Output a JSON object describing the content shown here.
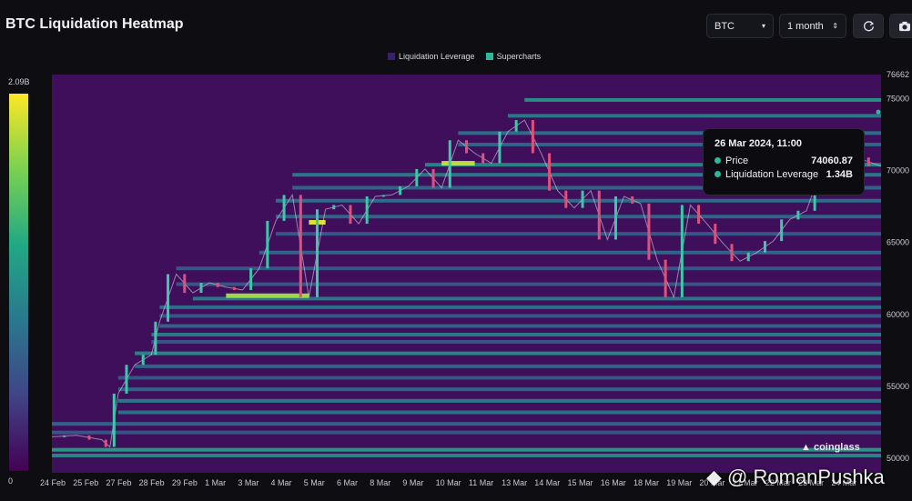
{
  "title": "BTC Liquidation Heatmap",
  "controls": {
    "coin": "BTC",
    "range": "1 month",
    "refresh_icon": "refresh-icon",
    "camera_icon": "camera-icon"
  },
  "legend": [
    {
      "label": "Liquidation Leverage",
      "color": "#3b1f6b"
    },
    {
      "label": "Supercharts",
      "color": "#2bb89c"
    }
  ],
  "colorbar": {
    "max_label": "2.09B",
    "min_label": "0"
  },
  "tooltip": {
    "date": "26 Mar 2024, 11:00",
    "price_label": "Price",
    "price_value": "74060.87",
    "leverage_label": "Liquidation Leverage",
    "leverage_value": "1.34B"
  },
  "brand": "coinglass",
  "watermark": "@ RomanPushka",
  "chart_data": {
    "type": "heatmap",
    "x_tick_labels": [
      "24 Feb",
      "25 Feb",
      "27 Feb",
      "28 Feb",
      "29 Feb",
      "1 Mar",
      "3 Mar",
      "4 Mar",
      "5 Mar",
      "6 Mar",
      "8 Mar",
      "9 Mar",
      "10 Mar",
      "11 Mar",
      "13 Mar",
      "14 Mar",
      "15 Mar",
      "16 Mar",
      "18 Mar",
      "19 Mar",
      "20 Mar",
      "21 Mar",
      "22 Mar",
      "23 Mar",
      "24 Mar",
      "25 Mar"
    ],
    "y_tick_labels": [
      "76662",
      "75000",
      "70000",
      "65000",
      "60000",
      "55000",
      "50000"
    ],
    "y_ticks": [
      76662,
      75000,
      70000,
      65000,
      60000,
      55000,
      50000
    ],
    "ylim": [
      49000,
      76662
    ],
    "price_series": [
      {
        "t": 0,
        "v": 51500
      },
      {
        "t": 0.03,
        "v": 51600
      },
      {
        "t": 0.06,
        "v": 51300
      },
      {
        "t": 0.07,
        "v": 50800
      },
      {
        "t": 0.08,
        "v": 54500
      },
      {
        "t": 0.1,
        "v": 56500
      },
      {
        "t": 0.12,
        "v": 57200
      },
      {
        "t": 0.13,
        "v": 59500
      },
      {
        "t": 0.15,
        "v": 62800
      },
      {
        "t": 0.17,
        "v": 61500
      },
      {
        "t": 0.19,
        "v": 62200
      },
      {
        "t": 0.21,
        "v": 61900
      },
      {
        "t": 0.23,
        "v": 61700
      },
      {
        "t": 0.25,
        "v": 63200
      },
      {
        "t": 0.27,
        "v": 66500
      },
      {
        "t": 0.29,
        "v": 68300
      },
      {
        "t": 0.31,
        "v": 61200
      },
      {
        "t": 0.33,
        "v": 67300
      },
      {
        "t": 0.35,
        "v": 67600
      },
      {
        "t": 0.37,
        "v": 66300
      },
      {
        "t": 0.39,
        "v": 68200
      },
      {
        "t": 0.41,
        "v": 68300
      },
      {
        "t": 0.43,
        "v": 68900
      },
      {
        "t": 0.45,
        "v": 70100
      },
      {
        "t": 0.47,
        "v": 68800
      },
      {
        "t": 0.49,
        "v": 72100
      },
      {
        "t": 0.51,
        "v": 71200
      },
      {
        "t": 0.53,
        "v": 70500
      },
      {
        "t": 0.55,
        "v": 72700
      },
      {
        "t": 0.57,
        "v": 73500
      },
      {
        "t": 0.59,
        "v": 71200
      },
      {
        "t": 0.61,
        "v": 68600
      },
      {
        "t": 0.63,
        "v": 67400
      },
      {
        "t": 0.65,
        "v": 68600
      },
      {
        "t": 0.67,
        "v": 65200
      },
      {
        "t": 0.69,
        "v": 68200
      },
      {
        "t": 0.71,
        "v": 67700
      },
      {
        "t": 0.73,
        "v": 63800
      },
      {
        "t": 0.75,
        "v": 61200
      },
      {
        "t": 0.77,
        "v": 67600
      },
      {
        "t": 0.79,
        "v": 66300
      },
      {
        "t": 0.81,
        "v": 64900
      },
      {
        "t": 0.83,
        "v": 63700
      },
      {
        "t": 0.85,
        "v": 64300
      },
      {
        "t": 0.87,
        "v": 65100
      },
      {
        "t": 0.89,
        "v": 66600
      },
      {
        "t": 0.91,
        "v": 67200
      },
      {
        "t": 0.93,
        "v": 70400
      },
      {
        "t": 0.95,
        "v": 71200
      },
      {
        "t": 0.97,
        "v": 70900
      },
      {
        "t": 1.0,
        "v": 70300
      }
    ],
    "heat_levels": [
      {
        "price": 74900,
        "intensity": 0.55
      },
      {
        "price": 73800,
        "intensity": 0.45
      },
      {
        "price": 72600,
        "intensity": 0.4
      },
      {
        "price": 71800,
        "intensity": 0.35
      },
      {
        "price": 70400,
        "intensity": 0.5
      },
      {
        "price": 69700,
        "intensity": 0.45
      },
      {
        "price": 68800,
        "intensity": 0.35
      },
      {
        "price": 67900,
        "intensity": 0.4
      },
      {
        "price": 66800,
        "intensity": 0.35
      },
      {
        "price": 65600,
        "intensity": 0.3
      },
      {
        "price": 64300,
        "intensity": 0.35
      },
      {
        "price": 63200,
        "intensity": 0.3
      },
      {
        "price": 62100,
        "intensity": 0.3
      },
      {
        "price": 61100,
        "intensity": 0.45
      },
      {
        "price": 60500,
        "intensity": 0.4
      },
      {
        "price": 59900,
        "intensity": 0.3
      },
      {
        "price": 59200,
        "intensity": 0.35
      },
      {
        "price": 58600,
        "intensity": 0.45
      },
      {
        "price": 58100,
        "intensity": 0.3
      },
      {
        "price": 57300,
        "intensity": 0.5
      },
      {
        "price": 56400,
        "intensity": 0.35
      },
      {
        "price": 55600,
        "intensity": 0.3
      },
      {
        "price": 54800,
        "intensity": 0.35
      },
      {
        "price": 54000,
        "intensity": 0.45
      },
      {
        "price": 53200,
        "intensity": 0.4
      },
      {
        "price": 52400,
        "intensity": 0.35
      },
      {
        "price": 51800,
        "intensity": 0.3
      },
      {
        "price": 50600,
        "intensity": 0.6
      },
      {
        "price": 50200,
        "intensity": 0.5
      }
    ],
    "hot_spots": [
      {
        "price": 61300,
        "t_start": 0.21,
        "t_end": 0.31,
        "intensity": 0.85
      },
      {
        "price": 70500,
        "t_start": 0.47,
        "t_end": 0.51,
        "intensity": 0.9
      },
      {
        "price": 66400,
        "t_start": 0.31,
        "t_end": 0.33,
        "intensity": 0.95
      }
    ],
    "colormap": [
      "#440154",
      "#414487",
      "#2a788e",
      "#22a884",
      "#7ad151",
      "#fde725"
    ],
    "colorbar_range": [
      0,
      "2.09B"
    ],
    "grid": false
  }
}
